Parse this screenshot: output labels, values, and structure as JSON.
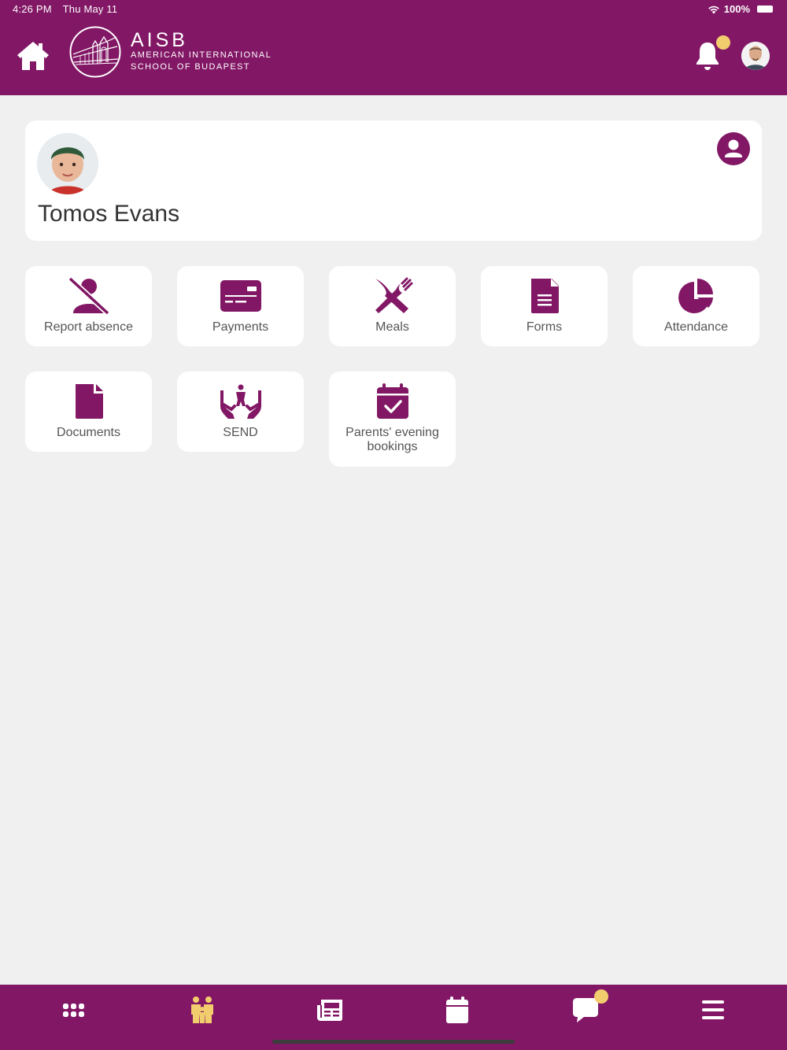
{
  "status_bar": {
    "time": "4:26 PM",
    "date": "Thu May 11",
    "battery": "100%"
  },
  "header": {
    "logo": {
      "title": "AISB",
      "line1": "AMERICAN INTERNATIONAL",
      "line2": "SCHOOL OF BUDAPEST"
    },
    "colors": {
      "brand": "#821765",
      "badge": "#f2cd6e"
    },
    "icons": [
      "home-icon",
      "bell-icon",
      "user-avatar"
    ]
  },
  "student": {
    "name": "Tomos Evans"
  },
  "tiles": [
    {
      "label": "Report absence",
      "icon": "user-slash-icon"
    },
    {
      "label": "Payments",
      "icon": "credit-card-icon"
    },
    {
      "label": "Meals",
      "icon": "utensils-icon"
    },
    {
      "label": "Forms",
      "icon": "document-lines-icon"
    },
    {
      "label": "Attendance",
      "icon": "pie-chart-icon"
    },
    {
      "label": "Documents",
      "icon": "file-icon"
    },
    {
      "label": "SEND",
      "icon": "hands-child-icon"
    },
    {
      "label": "Parents' evening bookings",
      "icon": "calendar-check-icon"
    }
  ],
  "bottom_nav": {
    "items": [
      "grid-icon",
      "family-icon",
      "newspaper-icon",
      "calendar-icon",
      "chat-icon",
      "menu-icon"
    ],
    "active": "family-icon"
  }
}
